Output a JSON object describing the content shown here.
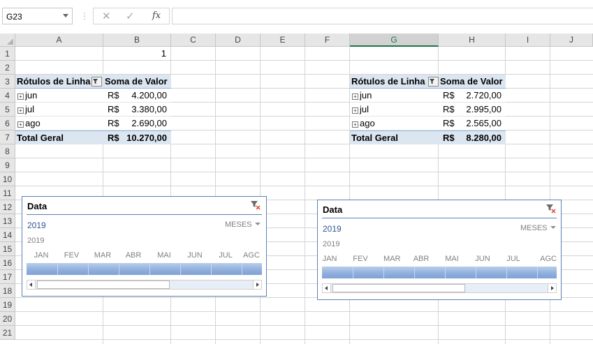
{
  "name_box": "G23",
  "formula_bar": {
    "cancel_icon": "✕",
    "enter_icon": "✓",
    "fx": "fx",
    "value": ""
  },
  "columns": [
    "A",
    "B",
    "C",
    "D",
    "E",
    "F",
    "G",
    "H",
    "I",
    "J"
  ],
  "rows": [
    "1",
    "2",
    "3",
    "4",
    "5",
    "6",
    "7",
    "8",
    "9",
    "10",
    "11",
    "12",
    "13",
    "14",
    "15",
    "16",
    "17",
    "18",
    "19",
    "20",
    "21"
  ],
  "cells": {
    "B1": "1"
  },
  "pivot_left": {
    "header_row_label": "Rótulos de Linha",
    "header_value": "Soma de Valor",
    "rows": [
      {
        "label": "jun",
        "currency": "R$",
        "value": "4.200,00"
      },
      {
        "label": "jul",
        "currency": "R$",
        "value": "3.380,00"
      },
      {
        "label": "ago",
        "currency": "R$",
        "value": "2.690,00"
      }
    ],
    "total": {
      "label": "Total Geral",
      "currency": "R$",
      "value": "10.270,00"
    }
  },
  "pivot_right": {
    "header_row_label": "Rótulos de Linha",
    "header_value": "Soma de Valor",
    "rows": [
      {
        "label": "jun",
        "currency": "R$",
        "value": "2.720,00"
      },
      {
        "label": "jul",
        "currency": "R$",
        "value": "2.995,00"
      },
      {
        "label": "ago",
        "currency": "R$",
        "value": "2.565,00"
      }
    ],
    "total": {
      "label": "Total Geral",
      "currency": "R$",
      "value": "8.280,00"
    }
  },
  "slicer_left": {
    "title": "Data",
    "selection": "2019",
    "level": "MESES",
    "year": "2019",
    "months": [
      "JAN",
      "FEV",
      "MAR",
      "ABR",
      "MAI",
      "JUN",
      "JUL",
      "AGC"
    ]
  },
  "slicer_right": {
    "title": "Data",
    "selection": "2019",
    "level": "MESES",
    "year": "2019",
    "months": [
      "JAN",
      "FEV",
      "MAR",
      "ABR",
      "MAI",
      "JUN",
      "JUL",
      "AGC"
    ]
  },
  "colors": {
    "pivot_header_bg": "#dce6f1",
    "slicer_border": "#5b7fb6",
    "selected_column": "#217346"
  },
  "icons": {
    "expand": "plus-box-icon",
    "filter": "filter-icon",
    "clear_filter": "clear-filter-icon"
  }
}
